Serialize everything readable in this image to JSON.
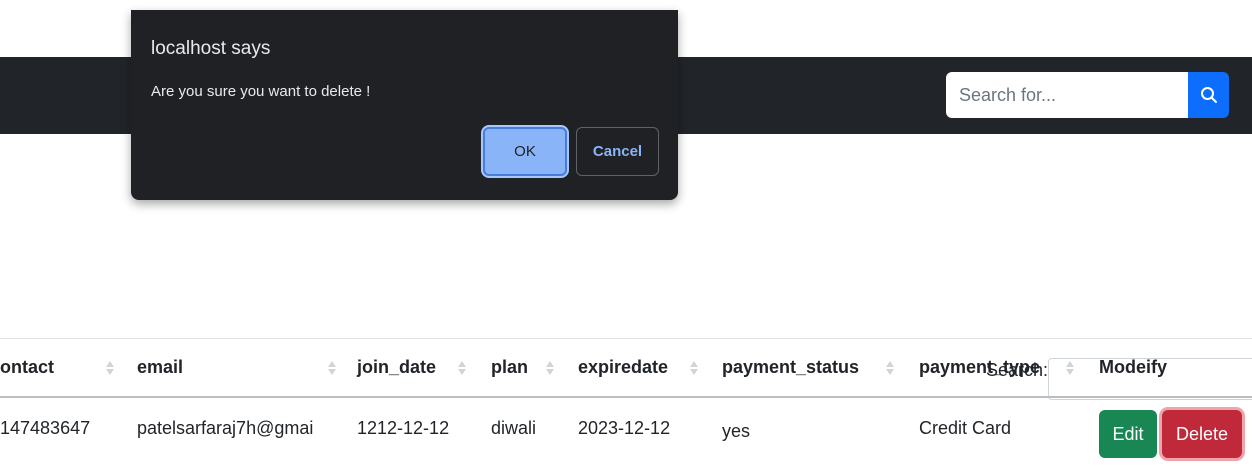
{
  "navbar": {
    "search_placeholder": "Search for...",
    "search_icon": "search-icon"
  },
  "datatable": {
    "search_label": "Search:",
    "columns": [
      "ontact",
      "email",
      "join_date",
      "plan",
      "expiredate",
      "payment_status",
      "payment_type",
      "Modeify"
    ],
    "rows": [
      {
        "contact": "147483647",
        "email": "patelsarfaraj7h@gmai",
        "join_date": "1212-12-12",
        "plan": "diwali",
        "expiredate": "2023-12-12",
        "payment_status": "yes",
        "payment_type": "Credit Card",
        "edit_label": "Edit",
        "delete_label": "Delete"
      }
    ]
  },
  "dialog": {
    "title": "localhost says",
    "message": "Are you sure you want to delete !",
    "ok_label": "OK",
    "cancel_label": "Cancel"
  },
  "colors": {
    "navbar": "#212529",
    "primary": "#0d6efd",
    "success": "#198754",
    "danger": "#c0293a",
    "dialog_bg": "#202124",
    "dialog_accent": "#8ab4f8"
  }
}
